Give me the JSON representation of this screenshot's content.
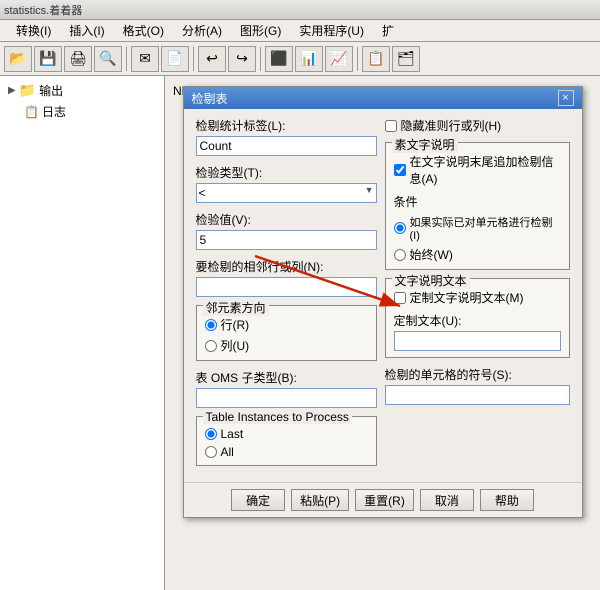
{
  "app": {
    "title": "statistics.着着器"
  },
  "menubar": {
    "items": [
      {
        "label": "转换(I)"
      },
      {
        "label": "插入(I)"
      },
      {
        "label": "格式(O)"
      },
      {
        "label": "分析(A)"
      },
      {
        "label": "图形(G)"
      },
      {
        "label": "实用程序(U)"
      },
      {
        "label": "扩"
      }
    ]
  },
  "toolbar": {
    "buttons": [
      "📁",
      "💾",
      "🖨",
      "🔍",
      "✉",
      "⬜",
      "⬜",
      "↩",
      "↪",
      "⬜",
      "⬜",
      "⬜",
      "⬜",
      "⬜",
      "⬜"
    ]
  },
  "tree": {
    "items": [
      {
        "label": "输出",
        "level": 0,
        "icon": "▶"
      },
      {
        "label": "日志",
        "level": 1,
        "icon": "📋"
      }
    ]
  },
  "new_file_label": "NEW FILE.",
  "dialog": {
    "title": "检剔表",
    "close_label": "×",
    "hide_row_col_label": "隐藏准则行或列(H)",
    "check_stat_label_label": "检剔统计标签(L):",
    "check_stat_label_value": "Count",
    "check_type_label": "检验类型(T):",
    "check_type_value": "<",
    "check_value_label": "检验值(V):",
    "check_value_value": "5",
    "adjacent_row_col_label": "要检剔的相邻行或列(N):",
    "adjacent_row_col_value": "",
    "neighbor_direction_section": "邻元素方向",
    "row_label": "行(R)",
    "col_label": "列(U)",
    "oms_subtype_label": "表 OMS 子类型(B):",
    "oms_subtype_value": "",
    "table_instances_section": "Table Instances to Process",
    "last_label": "Last",
    "all_label": "All",
    "element_desc_section": "素文字说明",
    "add_info_label": "在文字说明末尾追加检剔信息(A)",
    "condition_section": "条件",
    "if_actual_label": "如果实际已对单元格进行检剔(I)",
    "always_label": "始终(W)",
    "text_desc_section": "文字说明文本",
    "custom_text_label": "定制文字说明文本(M)",
    "custom_text_value_label": "定制文本(U):",
    "custom_text_value": "",
    "symbol_label": "检剔的单元格的符号(S):",
    "symbol_value": "",
    "ok_label": "确定",
    "paste_label": "粘贴(P)",
    "reset_label": "重置(R)",
    "cancel_label": "取消",
    "help_label": "帮助"
  },
  "arrow": {
    "color": "#cc0000"
  }
}
